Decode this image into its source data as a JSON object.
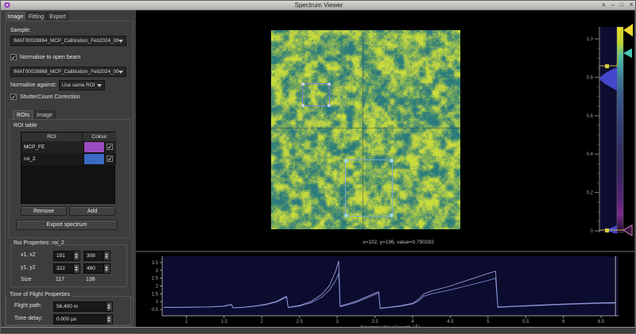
{
  "window": {
    "title": "Spectrum Viewer"
  },
  "icons": {
    "shade": "∧",
    "minimize": "–",
    "maximize": "□",
    "close": "✕",
    "check": "✓"
  },
  "left_panel": {
    "tabs": [
      {
        "label": "Image"
      },
      {
        "label": "Fitting"
      },
      {
        "label": "Export"
      }
    ],
    "sample_label": "Sample:",
    "sample_value": "IMAT00028864_MCP_Calibration_Feb2024_00",
    "normalise_checkbox_label": "Normalise to open beam",
    "open_beam_value": "IMAT00028868_MCP_Calibration_Feb2024_00",
    "normalise_against_label": "Normalise against:",
    "normalise_against_value": "Use same ROI",
    "shuttercount_checkbox_label": "ShutterCount Correction",
    "roi_tabs": [
      {
        "label": "ROIs"
      },
      {
        "label": "Image"
      }
    ],
    "roi_table": {
      "title": "ROI table",
      "columns": [
        "ROI",
        "Colour"
      ],
      "rows": [
        {
          "name": "MCP_FE",
          "colour": "#9b4bbf",
          "checked": true
        },
        {
          "name": "roi_2",
          "colour": "#3a6bc4",
          "checked": true
        }
      ]
    },
    "buttons": {
      "remove": "Remove",
      "add": "Add",
      "export": "Export spectrum"
    },
    "roi_properties": {
      "title": "Roi Properties: roi_2",
      "x_label": "x1, x2",
      "x1": "191",
      "x2": "308",
      "y_label": "y1, y2",
      "y1": "322",
      "y2": "460",
      "size_label": "Size",
      "size_w": "117",
      "size_h": "138"
    },
    "tof": {
      "title": "Time of Flight Properties",
      "flight_path_label": "Flight path:",
      "flight_path": "56.400 m",
      "time_delay_label": "Time delay:",
      "time_delay": "0.000 µs"
    }
  },
  "viewer": {
    "status_text": "x=102, y=196, value=0.790283",
    "colorbar": {
      "ticks": [
        {
          "label": "1.0",
          "value": 1.0
        },
        {
          "label": "0.8",
          "value": 0.8
        },
        {
          "label": "0.6",
          "value": 0.6
        },
        {
          "label": "0.4",
          "value": 0.4
        },
        {
          "label": "0.2",
          "value": 0.2
        },
        {
          "label": "0",
          "value": 0.0
        }
      ],
      "range": [
        0,
        1.0
      ],
      "histogram_peak_value": 0.8,
      "level_max": 0.86,
      "level_min": 0.005
    }
  },
  "chart_data": {
    "type": "line",
    "title": "",
    "xlabel": "Neutron Wavelength (Å)",
    "ylabel": "",
    "xlim": [
      0.68,
      6.73
    ],
    "ylim": [
      0.1,
      3.9
    ],
    "xticks": [
      1,
      1.5,
      2,
      2.5,
      3,
      3.5,
      4,
      4.5,
      5,
      5.5,
      6,
      6.5
    ],
    "yticks": [
      0.5,
      1,
      1.5,
      2,
      2.5,
      3,
      3.5
    ],
    "grid": false,
    "legend": "none",
    "end_marker_x": 6.69,
    "series": [
      {
        "name": "MCP_FE",
        "color": "#a79fe0",
        "points": [
          [
            0.7,
            0.64
          ],
          [
            0.9,
            0.64
          ],
          [
            1.1,
            0.65
          ],
          [
            1.3,
            0.67
          ],
          [
            1.5,
            0.72
          ],
          [
            1.57,
            0.8
          ],
          [
            1.6,
            0.82
          ],
          [
            1.62,
            0.61
          ],
          [
            1.75,
            0.64
          ],
          [
            1.9,
            0.72
          ],
          [
            2.05,
            0.83
          ],
          [
            2.2,
            1.02
          ],
          [
            2.3,
            1.28
          ],
          [
            2.33,
            1.34
          ],
          [
            2.35,
            0.64
          ],
          [
            2.5,
            0.76
          ],
          [
            2.65,
            1.0
          ],
          [
            2.8,
            1.48
          ],
          [
            2.9,
            2.05
          ],
          [
            2.98,
            2.95
          ],
          [
            3.02,
            3.6
          ],
          [
            3.04,
            0.72
          ],
          [
            3.1,
            0.8
          ],
          [
            3.25,
            1.02
          ],
          [
            3.4,
            1.33
          ],
          [
            3.52,
            1.58
          ],
          [
            3.55,
            1.63
          ],
          [
            3.57,
            0.58
          ],
          [
            3.7,
            0.65
          ],
          [
            3.85,
            0.75
          ],
          [
            4.0,
            0.9
          ],
          [
            4.08,
            1.15
          ],
          [
            4.15,
            1.5
          ],
          [
            4.25,
            1.68
          ],
          [
            4.5,
            2.0
          ],
          [
            4.75,
            2.4
          ],
          [
            5.0,
            2.8
          ],
          [
            5.1,
            2.95
          ],
          [
            5.13,
            0.66
          ],
          [
            5.3,
            0.7
          ],
          [
            5.6,
            0.77
          ],
          [
            6.0,
            0.85
          ],
          [
            6.4,
            0.91
          ],
          [
            6.69,
            0.95
          ]
        ]
      },
      {
        "name": "roi_2",
        "color": "#8193d9",
        "points": [
          [
            0.7,
            0.63
          ],
          [
            0.9,
            0.63
          ],
          [
            1.1,
            0.64
          ],
          [
            1.3,
            0.66
          ],
          [
            1.5,
            0.7
          ],
          [
            1.57,
            0.78
          ],
          [
            1.6,
            0.8
          ],
          [
            1.62,
            0.6
          ],
          [
            1.75,
            0.63
          ],
          [
            1.9,
            0.7
          ],
          [
            2.05,
            0.8
          ],
          [
            2.2,
            0.98
          ],
          [
            2.3,
            1.22
          ],
          [
            2.33,
            1.28
          ],
          [
            2.35,
            0.62
          ],
          [
            2.5,
            0.72
          ],
          [
            2.65,
            0.92
          ],
          [
            2.8,
            1.3
          ],
          [
            2.9,
            1.75
          ],
          [
            2.98,
            2.35
          ],
          [
            3.02,
            2.8
          ],
          [
            3.04,
            0.68
          ],
          [
            3.1,
            0.75
          ],
          [
            3.25,
            0.95
          ],
          [
            3.4,
            1.25
          ],
          [
            3.52,
            1.5
          ],
          [
            3.55,
            1.55
          ],
          [
            3.57,
            0.56
          ],
          [
            3.7,
            0.63
          ],
          [
            3.85,
            0.72
          ],
          [
            4.0,
            0.85
          ],
          [
            4.08,
            1.05
          ],
          [
            4.15,
            1.35
          ],
          [
            4.25,
            1.5
          ],
          [
            4.5,
            1.75
          ],
          [
            4.75,
            2.05
          ],
          [
            5.0,
            2.35
          ],
          [
            5.1,
            2.5
          ],
          [
            5.13,
            0.63
          ],
          [
            5.3,
            0.68
          ],
          [
            5.6,
            0.74
          ],
          [
            6.0,
            0.82
          ],
          [
            6.4,
            0.88
          ],
          [
            6.69,
            0.91
          ]
        ]
      }
    ]
  }
}
